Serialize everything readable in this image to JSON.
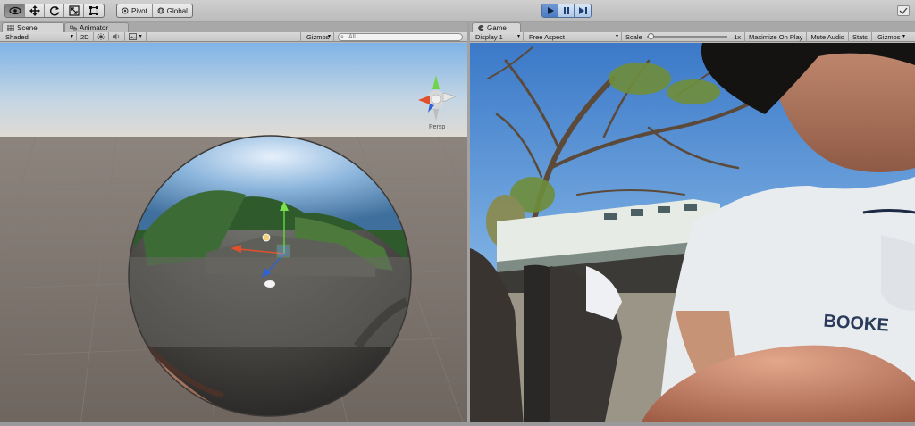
{
  "toolbar": {
    "tools": [
      {
        "name": "view-tool",
        "icon": "eye-icon",
        "active": true
      },
      {
        "name": "move-tool",
        "icon": "move-arrows-icon"
      },
      {
        "name": "rotate-tool",
        "icon": "rotate-icon"
      },
      {
        "name": "scale-tool",
        "icon": "scale-icon"
      },
      {
        "name": "rect-tool",
        "icon": "rect-icon"
      }
    ],
    "pivot_label": "Pivot",
    "global_label": "Global",
    "play_icons": [
      "play-icon",
      "pause-icon",
      "step-icon"
    ]
  },
  "scene": {
    "tabs": [
      "Scene",
      "Animator"
    ],
    "shading_mode": "Shaded",
    "mode_2d": "2D",
    "gizmos_label": "Gizmos",
    "search_placeholder": "All",
    "persp_label": "Persp"
  },
  "game": {
    "tab": "Game",
    "display": "Display 1",
    "aspect": "Free Aspect",
    "scale_label": "Scale",
    "scale_value": "1x",
    "scale_fraction": 0.02,
    "maximize_label": "Maximize On Play",
    "mute_label": "Mute Audio",
    "stats_label": "Stats",
    "gizmos_label": "Gizmos",
    "shirt_print": "BOOKE"
  },
  "colors": {
    "play_active": "#4a7cc2",
    "sky_top": "#7fb7ec",
    "ground": "#6f6761"
  }
}
